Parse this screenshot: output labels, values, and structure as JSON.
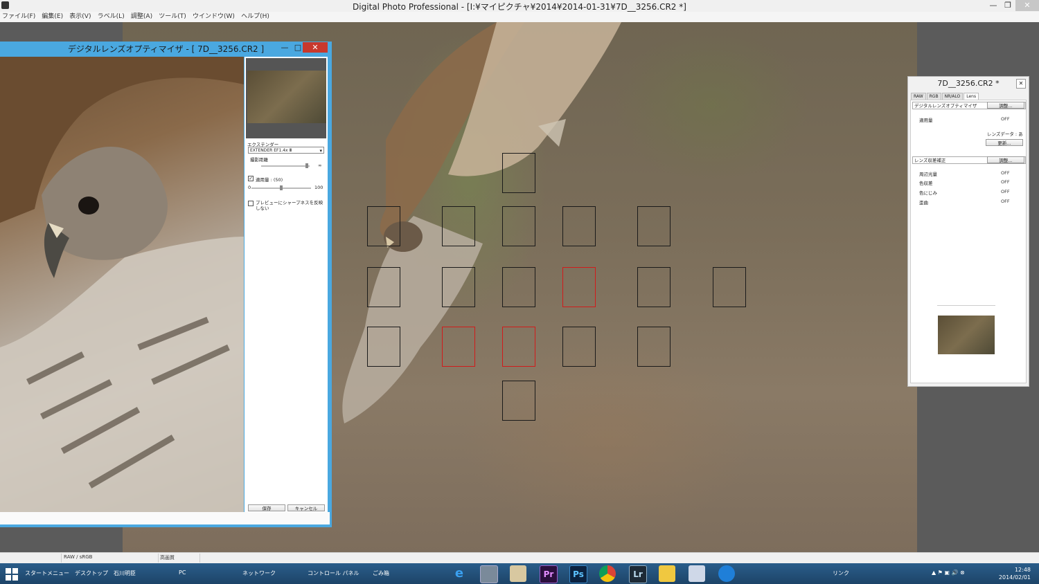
{
  "app": {
    "title": "Digital Photo Professional - [I:¥マイピクチャ¥2014¥2014-01-31¥7D__3256.CR2 *]",
    "minimize": "—",
    "maximize": "❐",
    "close": "✕"
  },
  "menu": [
    "ファイル(F)",
    "編集(E)",
    "表示(V)",
    "ラベル(L)",
    "調整(A)",
    "ツール(T)",
    "ウインドウ(W)",
    "ヘルプ(H)"
  ],
  "dlo": {
    "title": "デジタルレンズオプティマイザ - [ 7D__3256.CR2 ]",
    "minimize": "—",
    "maximize": "□",
    "close": "✕",
    "extender_label": "エクステンダー",
    "extender_value": "EXTENDER EF1.4x Ⅲ",
    "distance_label": "撮影距離",
    "distance_infinity": "∞",
    "amount_label": "適用量 : (50)",
    "amount_min": "0",
    "amount_max": "100",
    "amount_value": 50,
    "sharpness_label": "プレビューにシャープネスを反映しない",
    "save": "保存",
    "cancel": "キャンセル"
  },
  "palette": {
    "title": "7D__3256.CR2 *",
    "close": "✕",
    "tabs": [
      "RAW",
      "RGB",
      "NR/ALO",
      "Lens"
    ],
    "section1": "デジタルレンズオプティマイザ",
    "section1_btn": "調整...",
    "amount_label": "適用量",
    "amount_value": "OFF",
    "lensdata": "レンズデータ : あり",
    "update_btn": "更新...",
    "section2": "レンズ収差補正",
    "section2_btn": "調整...",
    "rows": [
      {
        "label": "周辺光量",
        "value": "OFF"
      },
      {
        "label": "色収差",
        "value": "OFF"
      },
      {
        "label": "色にじみ",
        "value": "OFF"
      },
      {
        "label": "歪曲",
        "value": "OFF"
      }
    ]
  },
  "status": {
    "color": "RAW / sRGB",
    "quality": "高画質"
  },
  "taskbar": {
    "start": "スタートメニュー",
    "desktop": "デスクトップ",
    "user": "石川明臣",
    "pc": "PC",
    "network": "ネットワーク",
    "control": "コントロール パネル",
    "trash": "ごみ箱",
    "links": "リンク",
    "time": "12:48",
    "date": "2014/02/01",
    "apps": [
      "e",
      "",
      "",
      "Pr",
      "Ps",
      "",
      "Lr",
      "",
      "",
      ""
    ]
  }
}
